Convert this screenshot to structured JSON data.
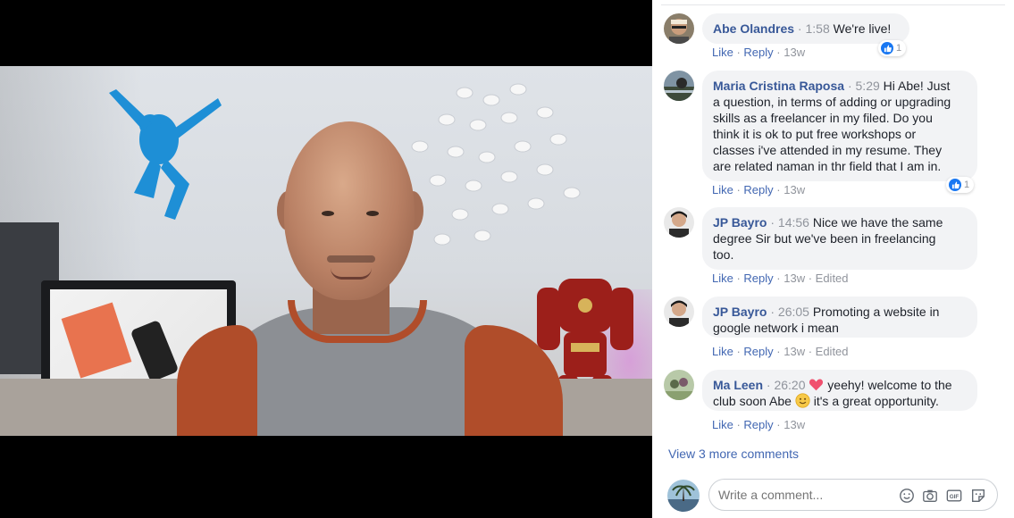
{
  "video": {
    "label": ""
  },
  "comments": [
    {
      "author": "Abe Olandres",
      "time": "1:58",
      "text": "We're live!",
      "actions": {
        "like": "Like",
        "reply": "Reply",
        "age": "13w",
        "edited": ""
      },
      "reactions": "1"
    },
    {
      "author": "Maria Cristina Raposa",
      "time": "5:29",
      "lines": [
        "Hi Abe! Just",
        "a question, in terms of adding or upgrading",
        "skills as a freelancer in my filed. Do you",
        "think it is ok to put free workshops or",
        "classes i've attended in my resume. They",
        "are related naman in thr field that I am in."
      ],
      "actions": {
        "like": "Like",
        "reply": "Reply",
        "age": "13w",
        "edited": ""
      },
      "reactions": "1"
    },
    {
      "author": "JP Bayro",
      "time": "14:56",
      "lines": [
        "Nice we have the same",
        "degree Sir but we've been in freelancing",
        "too."
      ],
      "actions": {
        "like": "Like",
        "reply": "Reply",
        "age": "13w",
        "edited": "Edited"
      }
    },
    {
      "author": "JP Bayro",
      "time": "26:05",
      "lines": [
        "Promoting a website in",
        "google network i mean"
      ],
      "actions": {
        "like": "Like",
        "reply": "Reply",
        "age": "13w",
        "edited": "Edited"
      }
    },
    {
      "author": "Ma Leen",
      "time": "26:20",
      "line1": "yeehy! welcome to the",
      "line2_a": "club soon Abe",
      "line2_b": "it's a great opportunity.",
      "actions": {
        "like": "Like",
        "reply": "Reply",
        "age": "13w",
        "edited": ""
      }
    }
  ],
  "view_more": "View 3 more comments",
  "composer": {
    "placeholder": "Write a comment..."
  },
  "colors": {
    "link": "#385898",
    "action": "#4267b2",
    "muted": "#90949c",
    "bubble": "#f2f3f5",
    "like": "#1877f2"
  }
}
